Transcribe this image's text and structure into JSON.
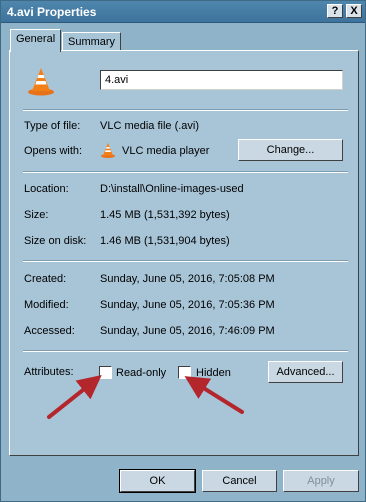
{
  "window": {
    "title": "4.avi Properties",
    "help_button": "?",
    "close_button": "X"
  },
  "tabs": [
    {
      "label": "General"
    },
    {
      "label": "Summary"
    }
  ],
  "file": {
    "name": "4.avi"
  },
  "props": {
    "type_label": "Type of file:",
    "type_value": "VLC media file (.avi)",
    "opens_label": "Opens with:",
    "opens_value": "VLC media player",
    "change_label": "Change...",
    "location_label": "Location:",
    "location_value": "D:\\install\\Online-images-used",
    "size_label": "Size:",
    "size_value": "1.45 MB (1,531,392 bytes)",
    "sizeondisk_label": "Size on disk:",
    "sizeondisk_value": "1.46 MB (1,531,904 bytes)",
    "created_label": "Created:",
    "created_value": "Sunday, June 05, 2016, 7:05:08 PM",
    "modified_label": "Modified:",
    "modified_value": "Sunday, June 05, 2016, 7:05:36 PM",
    "accessed_label": "Accessed:",
    "accessed_value": "Sunday, June 05, 2016, 7:46:09 PM",
    "attributes_label": "Attributes:",
    "readonly_label": "Read-only",
    "hidden_label": "Hidden",
    "advanced_label": "Advanced..."
  },
  "footer": {
    "ok_label": "OK",
    "cancel_label": "Cancel",
    "apply_label": "Apply"
  },
  "colors": {
    "arrow": "#b3262c",
    "vlc_orange": "#f57f17"
  },
  "icons": {
    "file_icon": "vlc-cone-icon",
    "opens_icon": "vlc-cone-icon"
  }
}
